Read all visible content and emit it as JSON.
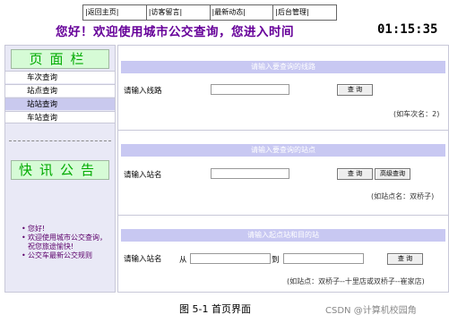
{
  "nav": [
    "|返回主页|",
    "|访客留言|",
    "|最新动态|",
    "|后台管理|"
  ],
  "header": {
    "greeting": "您好！欢迎使用城市公交查询，您进入时间",
    "clock": "01:15:35"
  },
  "sidebar": {
    "menu_title": "页面栏",
    "items": [
      "车次查询",
      "站点查询",
      "站站查询",
      "车站查询"
    ],
    "active_index": 2,
    "notice_title": "快讯公告",
    "notices": [
      "您好!",
      "欢迎使用城市公交查询，祝您旅途愉快!",
      "公交车最新公交规则"
    ]
  },
  "route_section": {
    "header": "请输入要查询的线路",
    "label": "请输入线路",
    "input_value": "",
    "button": "查 询",
    "hint": "(如车次名：2)"
  },
  "stop_section": {
    "header": "请输入要查询的站点",
    "label": "请输入站名",
    "input_value": "",
    "button": "查 询",
    "advanced_button": "高级查询",
    "hint": "(如站点名：双桥子)"
  },
  "station_section": {
    "header": "请输入起点站和目的站",
    "label": "请输入站名",
    "from_label": "从",
    "from_value": "",
    "to_label": "到",
    "to_value": "",
    "button": "查 询",
    "hint": "(如站点：双桥子--十里店或双桥子--崔家店)"
  },
  "caption": "图 5-1 首页界面",
  "watermark": "CSDN @计算机校园角"
}
